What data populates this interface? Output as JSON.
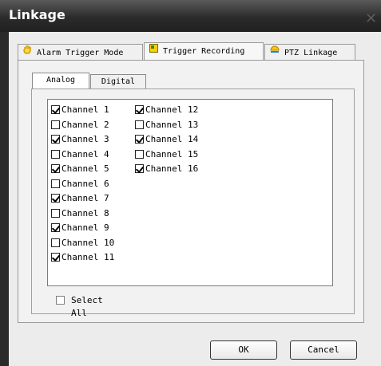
{
  "window": {
    "title": "Linkage",
    "close_glyph": "✕"
  },
  "tabs": [
    {
      "label": "Alarm Trigger Mode",
      "icon": "hand-icon"
    },
    {
      "label": "Trigger Recording",
      "icon": "record-icon"
    },
    {
      "label": "PTZ Linkage",
      "icon": "ptz-dome-icon"
    }
  ],
  "active_tab": "Trigger Recording",
  "subtabs": [
    {
      "label": "Analog"
    },
    {
      "label": "Digital"
    }
  ],
  "active_subtab": "Analog",
  "channels": [
    {
      "label": "Channel 1",
      "checked": true
    },
    {
      "label": "Channel 2",
      "checked": false
    },
    {
      "label": "Channel 3",
      "checked": true
    },
    {
      "label": "Channel 4",
      "checked": false
    },
    {
      "label": "Channel 5",
      "checked": true
    },
    {
      "label": "Channel 6",
      "checked": false
    },
    {
      "label": "Channel 7",
      "checked": true
    },
    {
      "label": "Channel 8",
      "checked": false
    },
    {
      "label": "Channel 9",
      "checked": true
    },
    {
      "label": "Channel 10",
      "checked": false
    },
    {
      "label": "Channel 11",
      "checked": true
    },
    {
      "label": "Channel 12",
      "checked": true
    },
    {
      "label": "Channel 13",
      "checked": false
    },
    {
      "label": "Channel 14",
      "checked": true
    },
    {
      "label": "Channel 15",
      "checked": false
    },
    {
      "label": "Channel 16",
      "checked": true
    }
  ],
  "select_all": {
    "label": "Select All",
    "checked": false
  },
  "buttons": {
    "ok": "OK",
    "cancel": "Cancel"
  }
}
